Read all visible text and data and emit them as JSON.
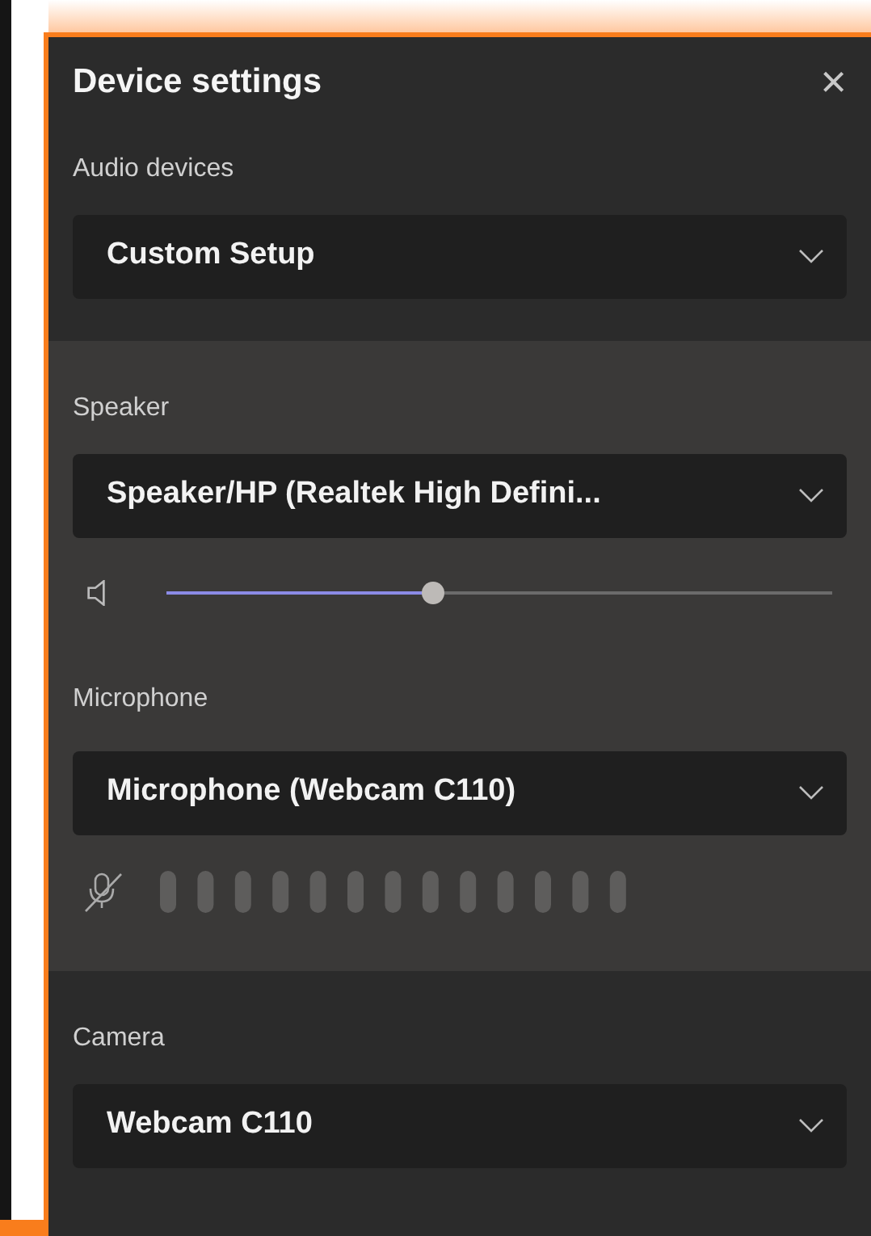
{
  "dialog": {
    "title": "Device settings",
    "close": "×"
  },
  "audio": {
    "label": "Audio devices",
    "value": "Custom Setup"
  },
  "speaker": {
    "label": "Speaker",
    "value": "Speaker/HP (Realtek High Defini...",
    "volume": {
      "level": 0.4
    }
  },
  "microphone": {
    "label": "Microphone",
    "value": "Microphone (Webcam C110)",
    "muted": true
  },
  "camera": {
    "label": "Camera",
    "value": "Webcam C110"
  }
}
